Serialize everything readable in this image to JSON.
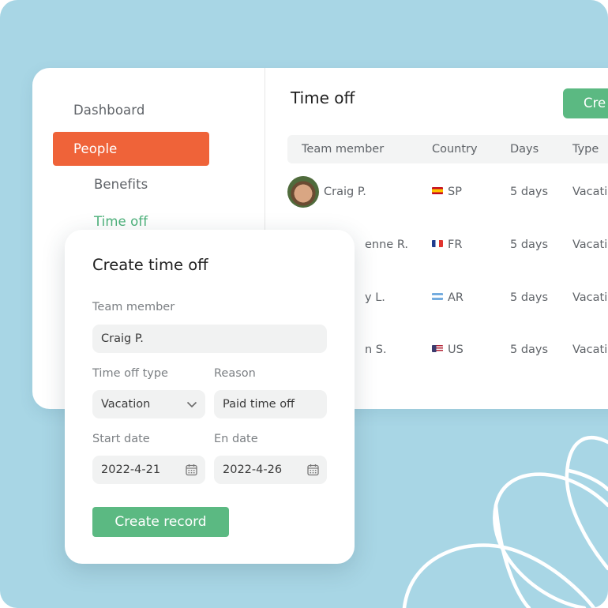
{
  "sidebar": {
    "items": [
      {
        "label": "Dashboard",
        "state": "default"
      },
      {
        "label": "People",
        "state": "active"
      },
      {
        "label": "Benefits",
        "state": "sub"
      },
      {
        "label": "Time off",
        "state": "sub-selected"
      }
    ]
  },
  "main": {
    "title": "Time off",
    "create_button": "Cre",
    "table": {
      "headers": [
        "Team member",
        "Country",
        "Days",
        "Type"
      ],
      "rows": [
        {
          "member": "Craig P.",
          "flag": "spain-flag-icon",
          "country": "SP",
          "days": "5 days",
          "type": "Vacati"
        },
        {
          "member": "enne R.",
          "flag": "france-flag-icon",
          "country": "FR",
          "days": "5 days",
          "type": "Vacati"
        },
        {
          "member": "y L.",
          "flag": "argentina-flag-icon",
          "country": "AR",
          "days": "5 days",
          "type": "Vacati"
        },
        {
          "member": "n S.",
          "flag": "usa-flag-icon",
          "country": "US",
          "days": "5 days",
          "type": "Vacati"
        }
      ]
    }
  },
  "modal": {
    "title": "Create time off",
    "team_member_label": "Team member",
    "team_member_value": "Craig P.",
    "type_label": "Time off type",
    "type_value": "Vacation",
    "reason_label": "Reason",
    "reason_value": "Paid time off",
    "start_label": "Start date",
    "start_value": "2022-4-21",
    "end_label": "En date",
    "end_value": "2022-4-26",
    "submit_label": "Create record"
  },
  "colors": {
    "background": "#a8d6e5",
    "accent_orange": "#ef6339",
    "accent_green": "#5bb982",
    "text_green": "#4cb17a"
  }
}
